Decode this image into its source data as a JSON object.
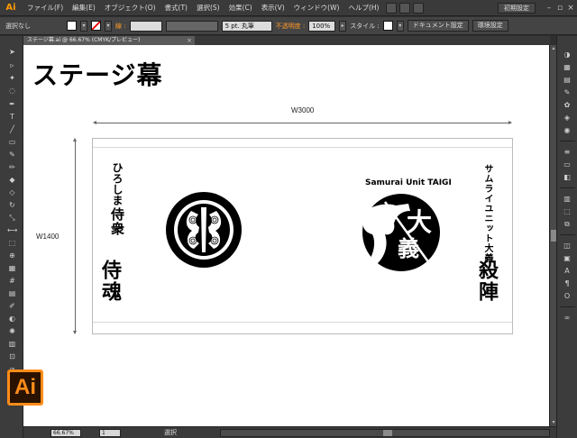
{
  "app": {
    "logo": "Ai",
    "workspace": "初期設定"
  },
  "menu": [
    "ファイル(F)",
    "編集(E)",
    "オブジェクト(O)",
    "書式(T)",
    "選択(S)",
    "効果(C)",
    "表示(V)",
    "ウィンドウ(W)",
    "ヘルプ(H)"
  ],
  "control_bar": {
    "selection": "選択なし",
    "stroke_label": "線 :",
    "brush": "5 pt. 丸筆",
    "opacity_label": "不透明度 :",
    "opacity_value": "100%",
    "style_label": "スタイル :",
    "doc_settings": "ドキュメント設定",
    "preferences": "環境設定"
  },
  "document_tab": {
    "title": "ステージ幕.ai @ 66.67% (CMYK/プレビュー)",
    "close": "×"
  },
  "canvas": {
    "headline": "ステージ幕",
    "width_label": "W3000",
    "height_label": "W1400",
    "banner": {
      "left_sub_1": "ひろしま",
      "left_sub_2": "侍衆",
      "left_main": "侍魂",
      "team_title": "Samurai Unit TAIGI",
      "emblem_chars": [
        "大",
        "義"
      ],
      "right_sub": "サムライユニット大義",
      "right_main": "殺陣"
    }
  },
  "status_bar": {
    "zoom": "66.67%",
    "page": "1",
    "status": "選択"
  },
  "badge": {
    "label": "Ai"
  },
  "colors": {
    "accent": "#ff8c1a",
    "canvas": "#ffffff",
    "chrome": "#3c3c3c"
  }
}
